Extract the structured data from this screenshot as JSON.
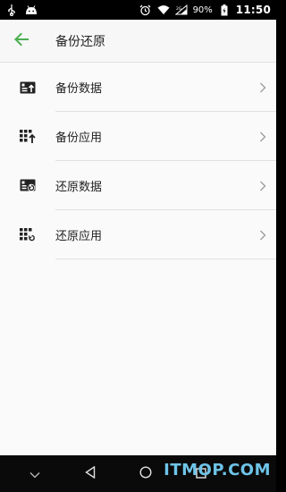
{
  "status_bar": {
    "battery_percent": "90%",
    "time": "11:50",
    "icons": [
      "usb-icon",
      "android-icon",
      "alarm-icon",
      "wifi-icon",
      "signal-icon",
      "battery-icon"
    ]
  },
  "app_bar": {
    "title": "备份还原",
    "back_icon": "arrow-left-icon"
  },
  "menu": {
    "items": [
      {
        "label": "备份数据",
        "icon": "backup-data-icon"
      },
      {
        "label": "备份应用",
        "icon": "backup-apps-icon"
      },
      {
        "label": "还原数据",
        "icon": "restore-data-icon"
      },
      {
        "label": "还原应用",
        "icon": "restore-apps-icon"
      }
    ],
    "chevron_icon": "chevron-right-icon"
  },
  "nav_bar": {
    "icons": [
      "chevron-down-icon",
      "back-triangle-icon",
      "home-circle-icon",
      "recents-square-icon"
    ]
  },
  "watermark": {
    "text": "ITMOP.COM"
  },
  "colors": {
    "accent": "#4caf50",
    "watermark": "#6ec4e8"
  }
}
